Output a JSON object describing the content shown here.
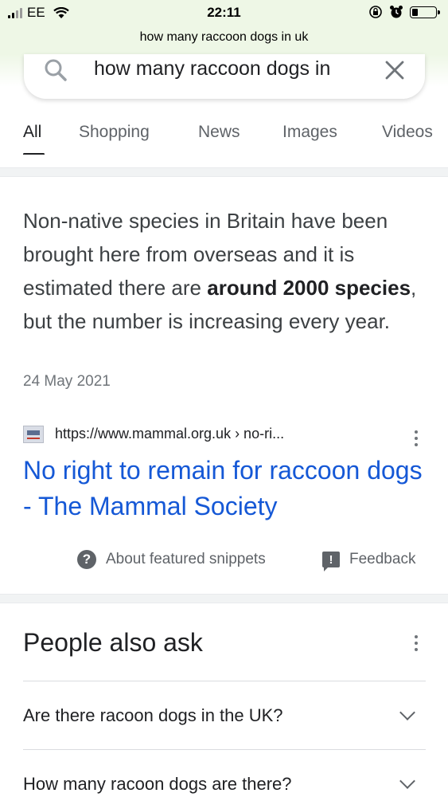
{
  "status": {
    "carrier": "EE",
    "time": "22:11"
  },
  "browser": {
    "url": "how many raccoon dogs in uk"
  },
  "search": {
    "query": "how many raccoon dogs in"
  },
  "tabs": [
    {
      "label": "All",
      "active": true
    },
    {
      "label": "Shopping"
    },
    {
      "label": "News"
    },
    {
      "label": "Images"
    },
    {
      "label": "Videos"
    }
  ],
  "snippet": {
    "text_before": "Non-native species in Britain have been brought here from overseas and it is estimated there are ",
    "text_bold": "around 2000 species",
    "text_after": ", but the number is increasing every year.",
    "date": "24 May 2021",
    "source_url": "https://www.mammal.org.uk › no-ri...",
    "title": "No right to remain for raccoon dogs - The Mammal Society",
    "about_label": "About featured snippets",
    "feedback_label": "Feedback"
  },
  "people_also_ask": {
    "title": "People also ask",
    "questions": [
      "Are there racoon dogs in the UK?",
      "How many racoon dogs are there?"
    ]
  },
  "colors": {
    "link": "#1558d6",
    "topbar": "#eef7e6"
  }
}
